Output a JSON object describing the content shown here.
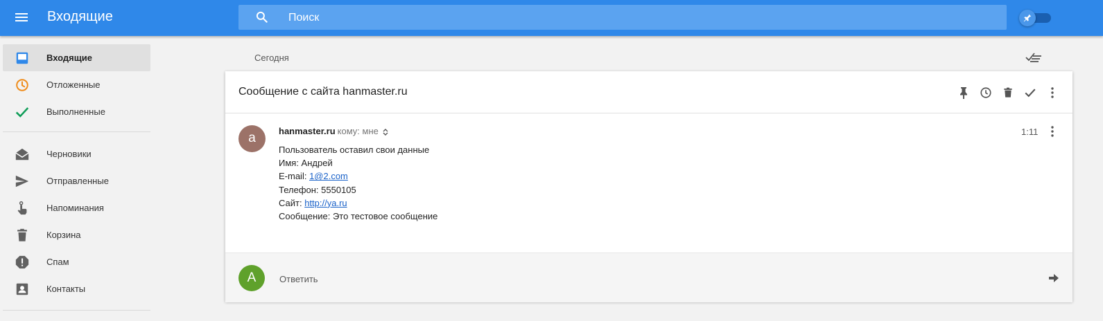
{
  "colors": {
    "topbar": "#2f88e9",
    "search_bg": "#5ba3f0",
    "snoozed_accent": "#ef8b18",
    "done_accent": "#0f9d58",
    "inbox_accent": "#2f88e9",
    "sender_avatar": "#9c7268",
    "reply_avatar": "#5fa12b",
    "link": "#1a62c9"
  },
  "topbar": {
    "menu_icon": "hamburger-icon",
    "title": "Входящие",
    "search_icon": "search-icon",
    "search_placeholder": "Поиск",
    "pin_toggle_icon": "pin-icon"
  },
  "sidebar": {
    "items": [
      {
        "label": "Входящие",
        "icon": "inbox-icon",
        "active": true
      },
      {
        "label": "Отложенные",
        "icon": "clock-icon"
      },
      {
        "label": "Выполненные",
        "icon": "check-icon"
      },
      {
        "label": "Черновики",
        "icon": "drafts-icon"
      },
      {
        "label": "Отправленные",
        "icon": "send-icon"
      },
      {
        "label": "Напоминания",
        "icon": "reminder-icon"
      },
      {
        "label": "Корзина",
        "icon": "trash-icon"
      },
      {
        "label": "Спам",
        "icon": "spam-icon"
      },
      {
        "label": "Контакты",
        "icon": "contacts-icon"
      }
    ]
  },
  "main": {
    "day_header": "Сегодня",
    "sweep_icon": "sweep-icon",
    "thread": {
      "subject": "Сообщение с сайта hanmaster.ru",
      "actions": [
        "pin-icon",
        "snooze-icon",
        "delete-icon",
        "done-icon",
        "more-vert-icon"
      ],
      "message": {
        "avatar_letter": "a",
        "sender": "hanmaster.ru",
        "recipient": "кому: мне",
        "time": "1:11",
        "body": {
          "line1": "Пользователь оставил свои данные",
          "name_line": "Имя: Андрей",
          "email_prefix": "E-mail: ",
          "email_link": "1@2.com",
          "phone_line": "Телефон: 5550105",
          "site_prefix": "Сайт: ",
          "site_link": "http://ya.ru",
          "message_line": "Сообщение: Это тестовое сообщение"
        }
      },
      "reply": {
        "avatar_letter": "A",
        "label": "Ответить",
        "send_icon": "forward-arrow-icon"
      }
    }
  }
}
